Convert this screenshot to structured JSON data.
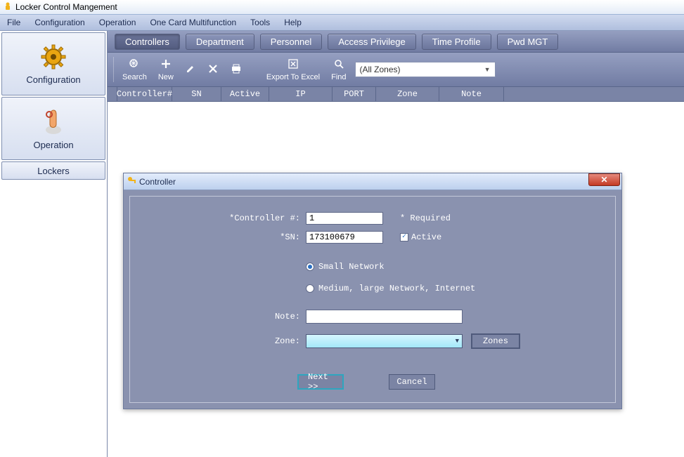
{
  "app": {
    "title": "Locker Control Mangement"
  },
  "menubar": {
    "items": [
      "File",
      "Configuration",
      "Operation",
      "One Card Multifunction",
      "Tools",
      "Help"
    ]
  },
  "sidebar": {
    "items": [
      {
        "label": "Configuration"
      },
      {
        "label": "Operation"
      },
      {
        "label": "Lockers"
      }
    ]
  },
  "tabs": {
    "items": [
      "Controllers",
      "Department",
      "Personnel",
      "Access Privilege",
      "Time Profile",
      "Pwd MGT"
    ],
    "active_index": 0
  },
  "toolbar": {
    "search": "Search",
    "new": "New",
    "export": "Export To Excel",
    "find": "Find",
    "zone_selected": "(All Zones)"
  },
  "grid": {
    "columns": [
      "Controller#",
      "SN",
      "Active",
      "IP",
      "PORT",
      "Zone",
      "Note"
    ],
    "widths": [
      78,
      70,
      68,
      90,
      62,
      90,
      92
    ]
  },
  "dialog": {
    "title": "Controller",
    "labels": {
      "controller_num": "*Controller #:",
      "sn": "*SN:",
      "required": "* Required",
      "active": "Active",
      "small_net": "Small Network",
      "large_net": "Medium, large Network, Internet",
      "note": "Note:",
      "zone": "Zone:",
      "zones_btn": "Zones",
      "next": "Next >>",
      "cancel": "Cancel"
    },
    "values": {
      "controller_num": "1",
      "sn": "173100679",
      "active_checked": true,
      "network_option": "small",
      "note": "",
      "zone": ""
    }
  }
}
